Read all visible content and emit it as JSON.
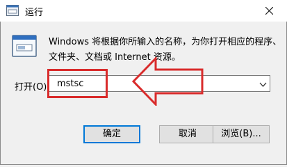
{
  "window": {
    "title": "运行"
  },
  "description": {
    "line1": "Windows 将根据你所输入的名称，为你打开相应的程序、",
    "line2": "文件夹、文档或 Internet 资源。"
  },
  "open_field": {
    "label": "打开(O):",
    "value": "mstsc"
  },
  "buttons": {
    "ok": "确定",
    "cancel": "取消",
    "browse": "浏览(B)..."
  },
  "icons": {
    "app": "run-icon",
    "close": "close-icon",
    "dropdown": "chevron-down-icon"
  },
  "colors": {
    "highlight": "#d92b2b",
    "focus": "#0078d7"
  }
}
